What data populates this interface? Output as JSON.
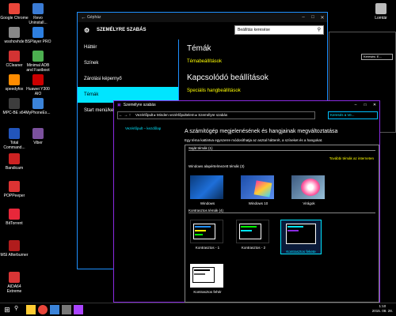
{
  "desktop": {
    "icons": [
      {
        "label": "Google Chrome",
        "color": "#e9463a"
      },
      {
        "label": "Revo Uninstall...",
        "color": "#3a7bd5"
      },
      {
        "label": "wsxhovhde",
        "color": "#888888"
      },
      {
        "label": "BSPlayer PRO",
        "color": "#2d7fe0"
      },
      {
        "label": "CCleaner",
        "color": "#d33333"
      },
      {
        "label": "Minimal ADB and Fastboot",
        "color": "#4caf50"
      },
      {
        "label": "speedyfox",
        "color": "#ff8c00"
      },
      {
        "label": "Huawei Y300 AIO",
        "color": "#cc0000"
      },
      {
        "label": "MPC-BE x64",
        "color": "#3d3d3d"
      },
      {
        "label": "MyPhoneEx...",
        "color": "#3b83d8"
      },
      {
        "label": "Total Command...",
        "color": "#2255bb"
      },
      {
        "label": "Viber",
        "color": "#7b519d"
      },
      {
        "label": "Bandicam",
        "color": "#cc2222"
      },
      {
        "label": "POPPeeper",
        "color": "#dd3333"
      },
      {
        "label": "BitTorrent",
        "color": "#e8273a"
      },
      {
        "label": "MSI Afterburner",
        "color": "#b01c1c"
      },
      {
        "label": "AIDA64 Extreme",
        "color": "#d73535"
      },
      {
        "label": "Lomtár",
        "color": "#bbbbbb"
      }
    ]
  },
  "settings": {
    "title": "Gépház",
    "header": "SZEMÉLYRE SZABÁS",
    "search_placeholder": "Beállítás keresése",
    "nav": [
      "Háttér",
      "Színek",
      "Zárolási képernyő",
      "Témák",
      "Start menü/ke..."
    ],
    "active_index": 3,
    "content": {
      "heading": "Témák",
      "link1": "Témabeállítások",
      "related_heading": "Kapcsolódó beállítások",
      "link2": "Speciális hangbeállítások"
    }
  },
  "bgwin": {
    "input": "Keresés: E..."
  },
  "personalization": {
    "title": "Személyre szabás",
    "address": "Vezérlőpult  ▸  Minden vezérlőpultelem  ▸  Személyre szabás",
    "search": "Keresés a Ve...",
    "side_link": "Vezérlőpult – kezdőlap",
    "main_title": "A számítógép megjelenésének és hangjainak megváltoztatása",
    "main_desc": "Egy téma kattintva egyszerre módosíthatja az asztal hátterét, a színeket és a hangokat.",
    "my_themes": "Saját témák (1)",
    "more_themes": "További témák az interneten",
    "default_themes": "Windows alapértelmezett témák (3)",
    "themes_default": [
      "Windows",
      "Windows 10",
      "Virágok"
    ],
    "contrast_themes": "Kontrasztos témák (4)",
    "themes_contrast": [
      "Kontrasztos - 1",
      "Kontrasztos - 2",
      "Kontrasztos fekete",
      "Kontrasztos fehér"
    ]
  },
  "taskbar": {
    "time": "1:10",
    "date": "2015. 08. 28."
  }
}
